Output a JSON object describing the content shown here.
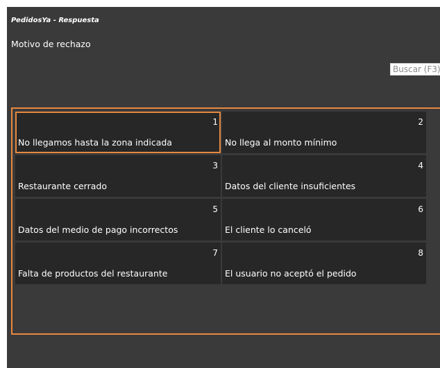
{
  "window": {
    "app_title": "PedidosYa - Respuesta",
    "subtitle": "Motivo de rechazo"
  },
  "search": {
    "placeholder": "Buscar (F3)"
  },
  "reasons": [
    {
      "number": "1",
      "label": "No llegamos hasta la zona indicada",
      "selected": true
    },
    {
      "number": "2",
      "label": "No llega al monto mínimo",
      "selected": false
    },
    {
      "number": "3",
      "label": "Restaurante cerrado",
      "selected": false
    },
    {
      "number": "4",
      "label": "Datos del cliente insuficientes",
      "selected": false
    },
    {
      "number": "5",
      "label": "Datos del medio de pago incorrectos",
      "selected": false
    },
    {
      "number": "6",
      "label": "El cliente lo canceló",
      "selected": false
    },
    {
      "number": "7",
      "label": "Falta de productos del restaurante",
      "selected": false
    },
    {
      "number": "8",
      "label": "El usuario no aceptó el pedido",
      "selected": false
    }
  ],
  "colors": {
    "background": "#3a3a3a",
    "tile": "#272727",
    "accent": "#e8893f",
    "text": "#ffffff"
  }
}
